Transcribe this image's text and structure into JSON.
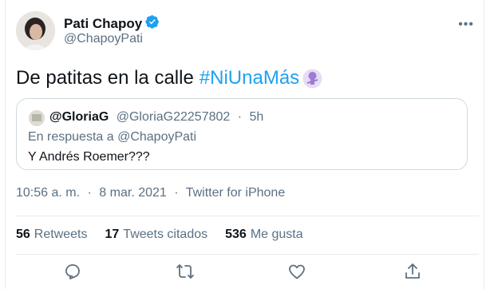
{
  "author": {
    "name": "Pati Chapoy",
    "handle": "@ChapoyPati",
    "verified": true
  },
  "more_icon": "more-icon",
  "tweet": {
    "text": "De patitas en la calle",
    "hashtag": "#NiUnaMás",
    "emoji": "raised-fist-emoji"
  },
  "quote": {
    "name": "@GloriaG",
    "handle": "@GloriaG22257802",
    "dot": "·",
    "time": "5h",
    "reply_prefix": "En respuesta a",
    "reply_to": "@ChapoyPati",
    "text": "Y Andrés Roemer???"
  },
  "meta": {
    "time": "10:56 a. m.",
    "dot1": "·",
    "date": "8 mar. 2021",
    "dot2": "·",
    "source": "Twitter for iPhone"
  },
  "stats": {
    "retweets_count": "56",
    "retweets_label": "Retweets",
    "quotes_count": "17",
    "quotes_label": "Tweets citados",
    "likes_count": "536",
    "likes_label": "Me gusta"
  },
  "actions": [
    "reply-icon",
    "retweet-icon",
    "like-icon",
    "share-icon"
  ],
  "colors": {
    "accent": "#1da1f2",
    "secondary_text": "#5b7083",
    "primary_text": "#0f1419",
    "border": "#cfd9de",
    "emoji_purple": "#9c7bd3"
  }
}
